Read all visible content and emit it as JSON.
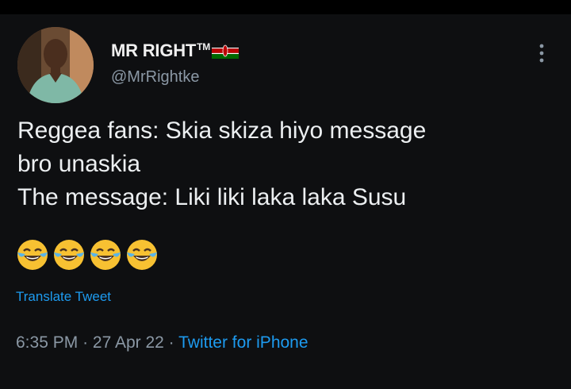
{
  "tweet": {
    "display_name": "MR RIGHT",
    "tm": "TM",
    "handle": "@MrRightke",
    "body_lines": [
      "Reggea fans: Skia skiza hiyo message",
      "bro unaskia",
      "The message: Liki liki laka laka Susu"
    ],
    "emojis": [
      "face-with-tears-of-joy",
      "face-with-tears-of-joy",
      "face-with-tears-of-joy",
      "face-with-tears-of-joy"
    ],
    "translate_label": "Translate Tweet",
    "time": "6:35 PM",
    "date": "27 Apr 22",
    "separator": "·",
    "source": "Twitter for iPhone"
  },
  "colors": {
    "link": "#1d9bf0",
    "muted": "#8b98a5",
    "background": "#0e0f11"
  }
}
